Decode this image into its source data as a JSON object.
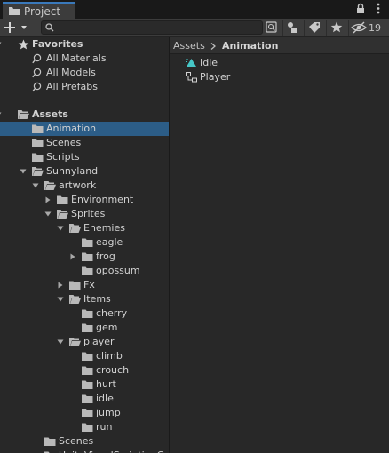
{
  "window": {
    "tab_title": "Project",
    "hidden_count": "19"
  },
  "toolbar": {
    "search_value": ""
  },
  "tree": {
    "favorites": {
      "label": "Favorites",
      "items": [
        {
          "label": "All Materials"
        },
        {
          "label": "All Models"
        },
        {
          "label": "All Prefabs"
        }
      ]
    },
    "assets_label": "Assets",
    "folders": [
      {
        "name": "Animation",
        "selected": true
      },
      {
        "name": "Scenes"
      },
      {
        "name": "Scripts"
      },
      {
        "name": "Sunnyland",
        "expanded": true
      },
      {
        "name": "artwork",
        "expanded": true
      },
      {
        "name": "Environment",
        "expanded": false
      },
      {
        "name": "Sprites",
        "expanded": true
      },
      {
        "name": "Enemies",
        "expanded": true
      },
      {
        "name": "eagle"
      },
      {
        "name": "frog",
        "expanded": false
      },
      {
        "name": "opossum"
      },
      {
        "name": "Fx",
        "expanded": false
      },
      {
        "name": "Items",
        "expanded": true
      },
      {
        "name": "cherry"
      },
      {
        "name": "gem"
      },
      {
        "name": "player",
        "expanded": true
      },
      {
        "name": "climb"
      },
      {
        "name": "crouch"
      },
      {
        "name": "hurt"
      },
      {
        "name": "idle"
      },
      {
        "name": "jump"
      },
      {
        "name": "run"
      },
      {
        "name": "Scenes"
      },
      {
        "name": "UnityVisualScriptingG..."
      }
    ]
  },
  "breadcrumb": {
    "root": "Assets",
    "current": "Animation"
  },
  "assets": [
    {
      "name": "Idle",
      "icon": "animation-clip-icon"
    },
    {
      "name": "Player",
      "icon": "animator-controller-icon"
    }
  ],
  "colors": {
    "selection": "#2c5d87",
    "tab_accent": "#3a79bb",
    "background": "#282828"
  }
}
